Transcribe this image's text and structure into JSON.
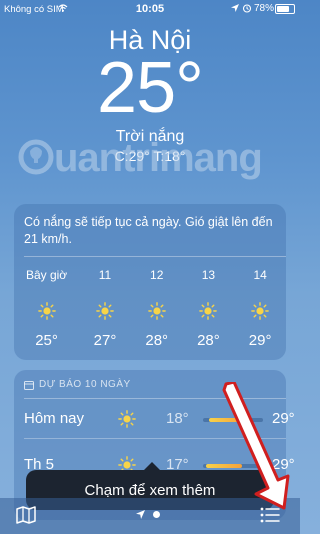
{
  "status_bar": {
    "carrier": "Không có SIM",
    "time": "10:05",
    "battery": "78%"
  },
  "location": {
    "city": "Hà Nội",
    "temperature": "25°",
    "condition": "Trời nắng",
    "high_low": "C:29°  T:18°"
  },
  "watermark": "uantrimang",
  "hourly": {
    "summary": "Có nắng sẽ tiếp tục cả ngày. Gió giật lên đến 21 km/h.",
    "items": [
      {
        "hour": "Bây giờ",
        "icon": "sun-icon",
        "temp": "25°"
      },
      {
        "hour": "11",
        "icon": "sun-icon",
        "temp": "27°"
      },
      {
        "hour": "12",
        "icon": "sun-icon",
        "temp": "28°"
      },
      {
        "hour": "13",
        "icon": "sun-icon",
        "temp": "28°"
      },
      {
        "hour": "14",
        "icon": "sun-icon",
        "temp": "29°"
      }
    ]
  },
  "daily": {
    "title": "DỰ BÁO 10 NGÀY",
    "days": [
      {
        "day": "Hôm nay",
        "icon": "sun-icon",
        "low": "18°",
        "high": "29°",
        "range_start": 0.1,
        "range_end": 0.7
      },
      {
        "day": "Th 5",
        "icon": "sun-icon",
        "low": "17°",
        "high": "29°",
        "range_start": 0.05,
        "range_end": 0.65
      }
    ]
  },
  "tooltip": {
    "text": "Chạm để xem thêm"
  },
  "colors": {
    "accent_arrow": "#d01f1f",
    "temp_bar": "#f5a13a"
  }
}
